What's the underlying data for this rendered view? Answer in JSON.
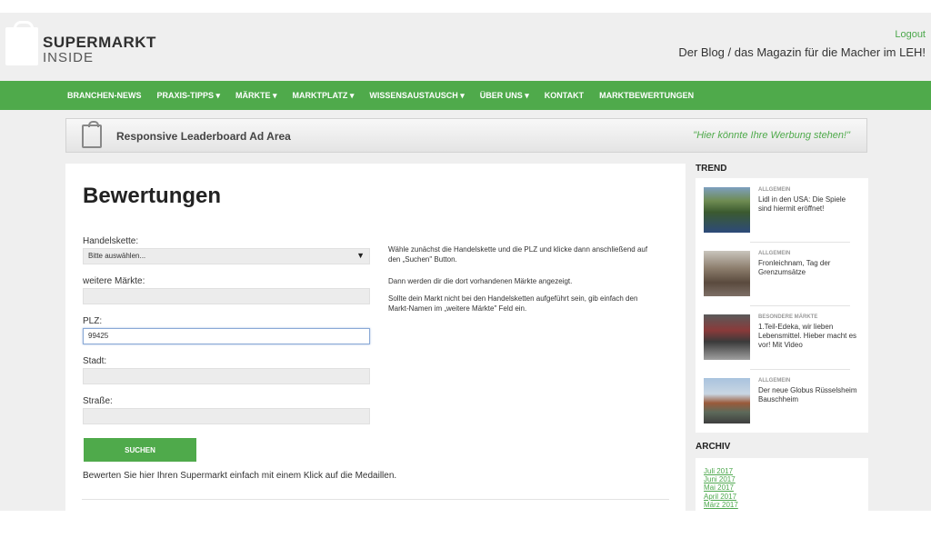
{
  "header": {
    "logo_line1": "SUPERMARKT",
    "logo_line2": "INSIDE",
    "logout": "Logout",
    "tagline": "Der Blog / das Magazin für die Macher im LEH!"
  },
  "nav": [
    "BRANCHEN-NEWS",
    "PRAXIS-TIPPS ▾",
    "MÄRKTE ▾",
    "MARKTPLATZ ▾",
    "WISSENSAUSTAUSCH ▾",
    "ÜBER UNS ▾",
    "KONTAKT",
    "MARKTBEWERTUNGEN"
  ],
  "ad": {
    "title": "Responsive Leaderboard Ad Area",
    "slogan": "\"Hier könnte Ihre Werbung stehen!\""
  },
  "form": {
    "title": "Bewertungen",
    "chain_label": "Handelskette:",
    "chain_selected": "Bitte auswählen...",
    "more_label": "weitere Märkte:",
    "more_value": "",
    "plz_label": "PLZ:",
    "plz_value": "99425",
    "city_label": "Stadt:",
    "city_value": "",
    "street_label": "Straße:",
    "street_value": "",
    "search_button": "SUCHEN",
    "bottom_text": "Bewerten Sie hier Ihren Supermarkt einfach mit einem Klick auf die Medaillen."
  },
  "info": {
    "p1": "Wähle zunächst die Handelskette und die PLZ und klicke dann anschließend auf den „Suchen\" Button.",
    "p2": "Dann werden dir die dort vorhandenen Märkte angezeigt.",
    "p3": "Sollte dein Markt nicht bei den Handelsketten aufgeführt sein, gib einfach den Markt-Namen im „weitere Märkte\" Feld ein."
  },
  "sidebar": {
    "trend_heading": "TREND",
    "trend": [
      {
        "category": "ALLGEMEIN",
        "title": "Lidl in den USA: Die Spiele sind hiermit eröffnet!"
      },
      {
        "category": "ALLGEMEIN",
        "title": "Fronleichnam, Tag der Grenzumsätze"
      },
      {
        "category": "BESONDERE MÄRKTE",
        "title": "1.Teil-Edeka, wir lieben Lebensmittel. Hieber macht es vor! Mit Video"
      },
      {
        "category": "ALLGEMEIN",
        "title": "Der neue Globus Rüsselsheim Bauschheim"
      }
    ],
    "archive_heading": "ARCHIV",
    "archive": [
      "Juli 2017",
      "Juni 2017",
      "Mai 2017",
      "April 2017",
      "März 2017"
    ]
  },
  "colors": {
    "accent_green": "#4faa4b",
    "link_green": "#4da84d",
    "page_bg": "#efefef"
  }
}
